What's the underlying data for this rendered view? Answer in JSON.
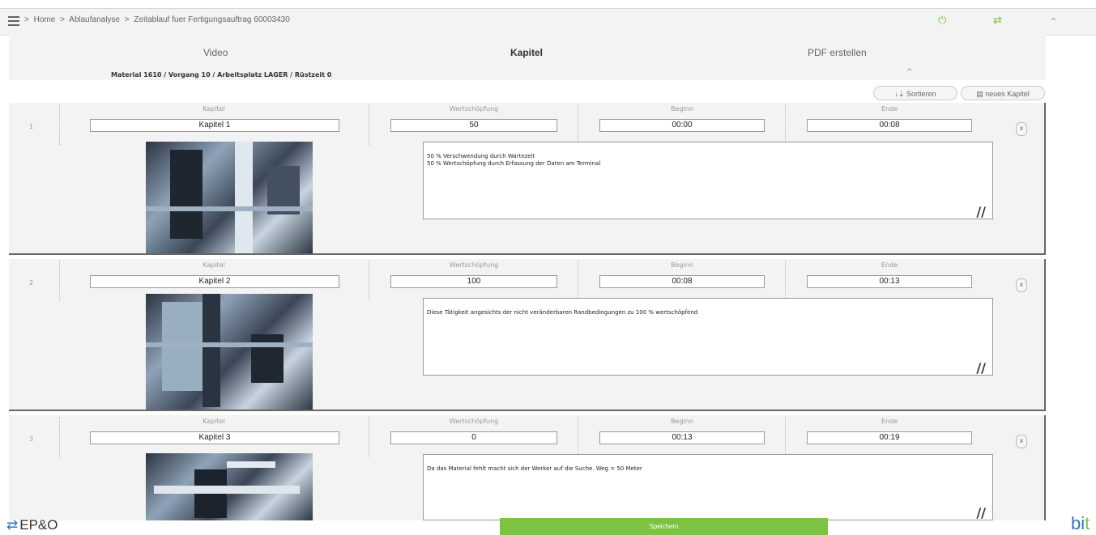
{
  "breadcrumb": [
    ">",
    "Home",
    ">",
    "Ablaufanalyse",
    ">",
    "Zeitablauf fuer Fertigungsauftrag 60003430"
  ],
  "tabs": {
    "video": "Video",
    "kapitel": "Kapitel",
    "pdf": "PDF erstellen"
  },
  "material_line": "Material 1610 / Vorgang 10 / Arbeitsplatz LAGER / Rüstzeit 0",
  "toolbar": {
    "sort": "Sortieren",
    "new_chapter": "neues Kapitel"
  },
  "columns": {
    "kapitel": "Kapitel",
    "wertschoepfung": "Wertschöpfung",
    "beginn": "Beginn",
    "ende": "Ende"
  },
  "chapters": [
    {
      "num": "1",
      "name": "Kapitel 1",
      "value": "50",
      "start": "00:00",
      "end": "00:08",
      "desc": "50 % Verschwendung durch Wartezeit\n50 % Wertschöpfung durch Erfassung der Daten am Terminal"
    },
    {
      "num": "2",
      "name": "Kapitel 2",
      "value": "100",
      "start": "00:08",
      "end": "00:13",
      "desc": "Diese Tätigkeit angesichts der nicht veränderbaren Randbedingungen zu 100 % wertschöpfend"
    },
    {
      "num": "3",
      "name": "Kapitel 3",
      "value": "0",
      "start": "00:13",
      "end": "00:19",
      "desc": "Da das Material fehlt macht sich der Werker auf die Suche. Weg = 50 Meter"
    }
  ],
  "close_label": "x",
  "footer": {
    "logo": "EP&O",
    "save": "Speichern",
    "bit_b": "b",
    "bit_i": "i",
    "bit_t": "t"
  },
  "colors": {
    "accent": "#7cc243",
    "brand_blue": "#2e78b7"
  }
}
